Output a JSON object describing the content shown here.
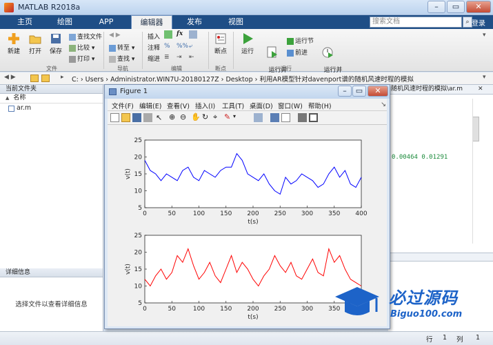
{
  "window": {
    "title": "MATLAB R2018a",
    "controls": [
      "–",
      "▭",
      "✕"
    ]
  },
  "ribbon_tabs": [
    "主页",
    "绘图",
    "APP",
    "编辑器",
    "发布",
    "视图"
  ],
  "search": {
    "placeholder": "搜索文档"
  },
  "login_label": "登录",
  "toolstrip": {
    "file": {
      "new_label": "新建",
      "open_label": "打开",
      "save_label": "保存",
      "find_files_label": "查找文件",
      "compare_label": "比较",
      "print_label": "打印",
      "group_label": "文件"
    },
    "nav": {
      "goto_label": "转至",
      "find_label": "查找",
      "group_label": "导航"
    },
    "edit": {
      "insert_label": "插入",
      "comment_label": "注释",
      "indent_label": "缩进",
      "fx_label": "fx",
      "group_label": "编辑"
    },
    "breakpoints": {
      "label": "断点",
      "group_label": "断点"
    },
    "run": {
      "run_label": "运行",
      "run_advance_label": "运行并\n前进",
      "run_section_label": "运行节",
      "advance_label": "前进",
      "run_time_label": "运行并\n计时",
      "group_label": "运行"
    }
  },
  "address": {
    "path": "C: › Users › Administrator.WIN7U-20180127Z › Desktop › 利用AR模型针对davenport谱的随机风速时程的模拟"
  },
  "current_folder": {
    "title": "当前文件夹",
    "column_name": "名称",
    "sort_arrow": "▲",
    "files": [
      "ar.m"
    ]
  },
  "details": {
    "title": "详细信息",
    "empty_message": "选择文件以查看详细信息"
  },
  "editor_tab": "随机风速时程的模拟\\ar.m",
  "editor_snippet": "0.00464  0.01291",
  "status": {
    "row_label": "行",
    "row": "1",
    "col_label": "列",
    "col": "1"
  },
  "figure": {
    "title": "Figure 1",
    "menus": [
      "文件(F)",
      "编辑(E)",
      "查看(V)",
      "插入(I)",
      "工具(T)",
      "桌面(D)",
      "窗口(W)",
      "帮助(H)"
    ]
  },
  "chart_data": [
    {
      "type": "line",
      "xlabel": "t(s)",
      "ylabel": "v(t)",
      "xlim": [
        0,
        400
      ],
      "ylim": [
        5,
        25
      ],
      "xticks": [
        0,
        50,
        100,
        150,
        200,
        250,
        300,
        350,
        400
      ],
      "yticks": [
        5,
        10,
        15,
        20,
        25
      ],
      "color": "#0000ff",
      "grid": false,
      "series": [
        {
          "x": [
            0,
            10,
            20,
            30,
            40,
            50,
            60,
            70,
            80,
            90,
            100,
            110,
            120,
            130,
            140,
            150,
            160,
            170,
            180,
            190,
            200,
            210,
            220,
            230,
            240,
            250,
            260,
            270,
            280,
            290,
            300,
            310,
            320,
            330,
            340,
            350,
            360,
            370,
            380,
            390,
            400
          ],
          "y": [
            19,
            16,
            15,
            13,
            15,
            14,
            13,
            16,
            17,
            14,
            13,
            16,
            15,
            14,
            16,
            17,
            17,
            21,
            19,
            15,
            14,
            13,
            15,
            12,
            10,
            9,
            14,
            12,
            13,
            15,
            14,
            13,
            11,
            12,
            15,
            17,
            14,
            16,
            12,
            11,
            14
          ]
        }
      ]
    },
    {
      "type": "line",
      "xlabel": "t(s)",
      "ylabel": "v(t)",
      "xlim": [
        0,
        400
      ],
      "ylim": [
        5,
        25
      ],
      "xticks": [
        0,
        50,
        100,
        150,
        200,
        250,
        300,
        350,
        400
      ],
      "yticks": [
        5,
        10,
        15,
        20,
        25
      ],
      "color": "#ff0000",
      "grid": false,
      "series": [
        {
          "x": [
            0,
            10,
            20,
            30,
            40,
            50,
            60,
            70,
            80,
            90,
            100,
            110,
            120,
            130,
            140,
            150,
            160,
            170,
            180,
            190,
            200,
            210,
            220,
            230,
            240,
            250,
            260,
            270,
            280,
            290,
            300,
            310,
            320,
            330,
            340,
            350,
            360,
            370,
            380,
            390,
            400
          ],
          "y": [
            12,
            10,
            13,
            15,
            12,
            14,
            19,
            17,
            21,
            16,
            12,
            14,
            17,
            13,
            11,
            15,
            19,
            14,
            17,
            15,
            12,
            10,
            13,
            15,
            19,
            16,
            14,
            17,
            13,
            12,
            15,
            18,
            14,
            13,
            21,
            17,
            19,
            15,
            12,
            11,
            10
          ]
        }
      ]
    }
  ],
  "watermark": {
    "text": "必过源码",
    "url_text": "Biguo100.com"
  }
}
